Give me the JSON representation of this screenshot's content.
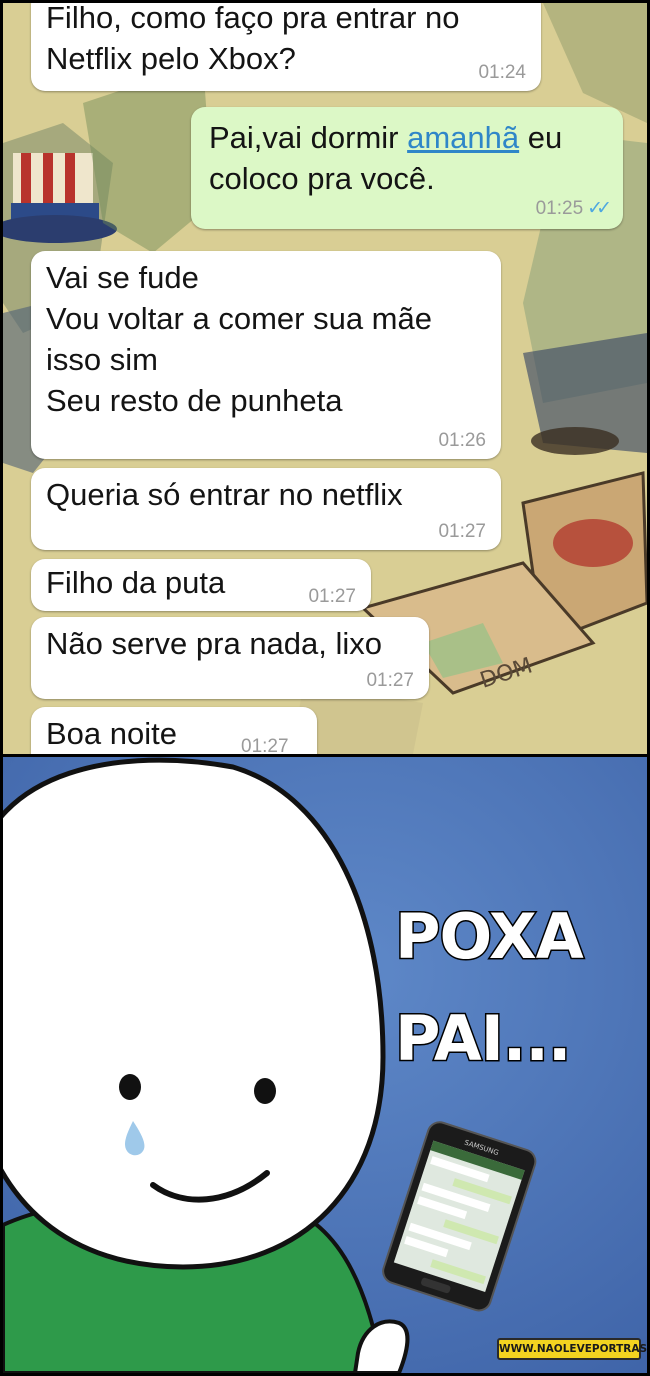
{
  "chat": {
    "messages": [
      {
        "from": "son",
        "text": "Filho, como faço pra entrar no\nNetflix pelo Xbox?",
        "time": "01:24"
      },
      {
        "from": "dad",
        "text_before": "Pai,vai dormir ",
        "link": "amanhã",
        "text_after": " eu\ncoloco pra você.",
        "time": "01:25",
        "ticks": "✓✓"
      },
      {
        "from": "son",
        "text": "Vai se fude\nVou voltar a comer sua mãe\nisso sim\nSeu resto de punheta",
        "time": "01:26"
      },
      {
        "from": "son",
        "text": "Queria só entrar no netflix",
        "time": "01:27"
      },
      {
        "from": "son",
        "text": "Filho da puta",
        "time": "01:27"
      },
      {
        "from": "son",
        "text": "Não serve pra nada, lixo",
        "time": "01:27"
      },
      {
        "from": "son",
        "text": "Boa noite",
        "time": "01:27"
      }
    ]
  },
  "meme": {
    "caption_line1": "POXA",
    "caption_line2": "PAI...",
    "phone_brand": "SAMSUNG",
    "watermark": "WWW.NAOLEVEPORTRAS.COM",
    "colors": {
      "background": "#4f78bb",
      "shirt": "#2e9a4a",
      "tear": "#9fc9ea"
    }
  }
}
